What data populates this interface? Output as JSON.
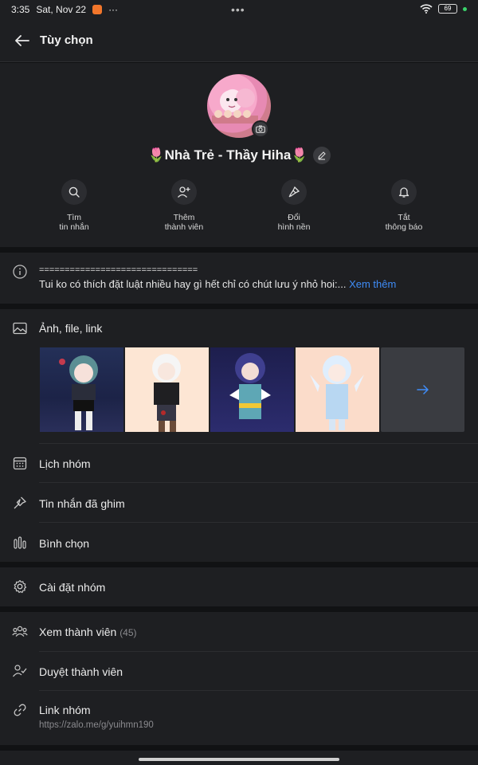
{
  "status_bar": {
    "time": "3:35",
    "date": "Sat, Nov 22",
    "overflow": "···",
    "center_dots": "•••",
    "battery": "69"
  },
  "header": {
    "title": "Tùy chọn"
  },
  "profile": {
    "group_name": "🌷Nhà Trẻ - Thầy Hiha🌷"
  },
  "actions": [
    {
      "label_line1": "Tìm",
      "label_line2": "tin nhắn",
      "icon": "search-icon"
    },
    {
      "label_line1": "Thêm",
      "label_line2": "thành viên",
      "icon": "add-member-icon"
    },
    {
      "label_line1": "Đổi",
      "label_line2": "hình nền",
      "icon": "paint-brush-icon"
    },
    {
      "label_line1": "Tắt",
      "label_line2": "thông báo",
      "icon": "bell-icon"
    }
  ],
  "about": {
    "line1": "===============================",
    "line2": "Tui ko có thích đặt luật nhiều hay gì hết chỉ có chút lưu ý nhỏ hoi:...",
    "more": "Xem thêm"
  },
  "media": {
    "title": "Ảnh, file, link"
  },
  "menu": {
    "calendar": "Lịch nhóm",
    "pinned": "Tin nhắn đã ghim",
    "poll": "Bình chọn",
    "settings": "Cài đặt nhóm",
    "members": "Xem thành viên",
    "members_count": "(45)",
    "approve": "Duyệt thành viên",
    "link": "Link nhóm",
    "link_url": "https://zalo.me/g/yuihmn190"
  },
  "colors": {
    "background": "#111214",
    "surface": "#1e1f22",
    "accent_link": "#3f8cf7",
    "status_green": "#3ad36b"
  }
}
